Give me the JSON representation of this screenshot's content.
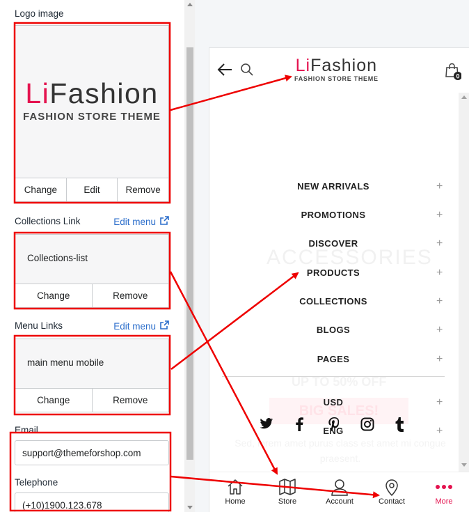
{
  "settings": {
    "logo_label": "Logo image",
    "logo_card": {
      "change": "Change",
      "edit": "Edit",
      "remove": "Remove"
    },
    "collections": {
      "label": "Collections Link",
      "edit_menu": "Edit menu",
      "value": "Collections-list",
      "change": "Change",
      "remove": "Remove"
    },
    "menu_links": {
      "label": "Menu Links",
      "edit_menu": "Edit menu",
      "value": "main menu mobile",
      "change": "Change",
      "remove": "Remove"
    },
    "email": {
      "label": "Email",
      "value": "support@themeforshop.com"
    },
    "telephone": {
      "label": "Telephone",
      "value": "(+10)1900.123.678"
    }
  },
  "logo": {
    "brand_prefix": "Li",
    "brand_suffix": "Fashion",
    "tagline": "FASHION STORE THEME",
    "prefix_color": "#e4134f",
    "suffix_color": "#333333"
  },
  "header": {
    "cart_count": "0"
  },
  "menu": {
    "items": [
      "NEW ARRIVALS",
      "PROMOTIONS",
      "DISCOVER",
      "PRODUCTS",
      "COLLECTIONS",
      "BLOGS",
      "PAGES"
    ],
    "currency": "USD",
    "language": "ENG",
    "plus": "+"
  },
  "background_ghost": {
    "heading": "ACCESSORIES",
    "promo": "UP TO 50% OFF",
    "sale": "BIG SALES!",
    "body": "Sed, lorem amet purus class est amet mi congue praesent."
  },
  "social_icons": [
    "twitter-icon",
    "facebook-icon",
    "pinterest-icon",
    "instagram-icon",
    "tumblr-icon"
  ],
  "bottom_nav": [
    {
      "label": "Home",
      "icon": "home-icon"
    },
    {
      "label": "Store",
      "icon": "map-icon"
    },
    {
      "label": "Account",
      "icon": "user-icon"
    },
    {
      "label": "Contact",
      "icon": "location-pin-icon"
    },
    {
      "label": "More",
      "icon": "more-dots-icon"
    }
  ],
  "colors": {
    "accent": "#e4134f",
    "link": "#2c6ecb",
    "annotation": "#ee0000"
  }
}
